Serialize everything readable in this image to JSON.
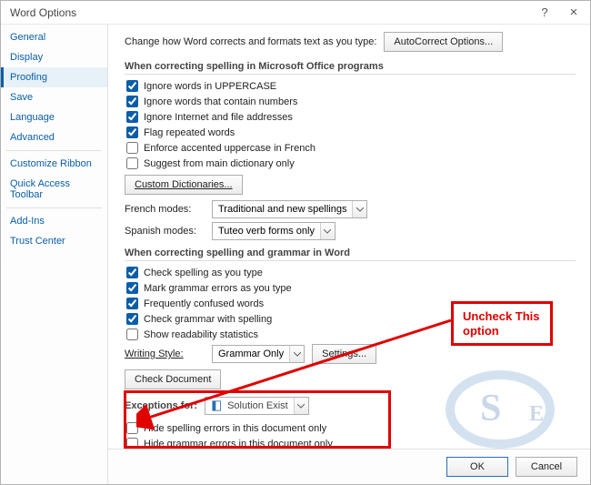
{
  "window": {
    "title": "Word Options",
    "help_icon": "?",
    "close_icon": "×"
  },
  "sidebar": {
    "items": [
      {
        "label": "General",
        "selected": false
      },
      {
        "label": "Display",
        "selected": false
      },
      {
        "label": "Proofing",
        "selected": true
      },
      {
        "label": "Save",
        "selected": false
      },
      {
        "label": "Language",
        "selected": false
      },
      {
        "label": "Advanced",
        "selected": false
      }
    ],
    "items2": [
      {
        "label": "Customize Ribbon"
      },
      {
        "label": "Quick Access Toolbar"
      }
    ],
    "items3": [
      {
        "label": "Add-Ins"
      },
      {
        "label": "Trust Center"
      }
    ]
  },
  "intro": {
    "text": "Change how Word corrects and formats text as you type:",
    "button": "AutoCorrect Options..."
  },
  "section1": {
    "title": "When correcting spelling in Microsoft Office programs",
    "cb": [
      {
        "checked": true,
        "label": "Ignore words in UPPERCASE"
      },
      {
        "checked": true,
        "label": "Ignore words that contain numbers"
      },
      {
        "checked": true,
        "label": "Ignore Internet and file addresses"
      },
      {
        "checked": true,
        "label": "Flag repeated words"
      },
      {
        "checked": false,
        "label": "Enforce accented uppercase in French"
      },
      {
        "checked": false,
        "label": "Suggest from main dictionary only"
      }
    ],
    "custom_dict_btn": "Custom Dictionaries...",
    "french_label": "French modes:",
    "french_value": "Traditional and new spellings",
    "spanish_label": "Spanish modes:",
    "spanish_value": "Tuteo verb forms only"
  },
  "section2": {
    "title": "When correcting spelling and grammar in Word",
    "cb": [
      {
        "checked": true,
        "label": "Check spelling as you type"
      },
      {
        "checked": true,
        "label": "Mark grammar errors as you type"
      },
      {
        "checked": true,
        "label": "Frequently confused words"
      },
      {
        "checked": true,
        "label": "Check grammar with spelling"
      },
      {
        "checked": false,
        "label": "Show readability statistics"
      }
    ],
    "writing_style_label": "Writing Style:",
    "writing_style_value": "Grammar Only",
    "settings_btn": "Settings...",
    "check_doc_btn": "Check Document"
  },
  "section3": {
    "title_prefix": "Exceptions for:",
    "doc_value": "Solution Exist",
    "cb": [
      {
        "checked": false,
        "label": "Hide spelling errors in this document only"
      },
      {
        "checked": false,
        "label": "Hide grammar errors in this document only"
      }
    ]
  },
  "footer": {
    "ok": "OK",
    "cancel": "Cancel"
  },
  "annotation": {
    "callout_line1": "Uncheck This",
    "callout_line2": "option"
  }
}
